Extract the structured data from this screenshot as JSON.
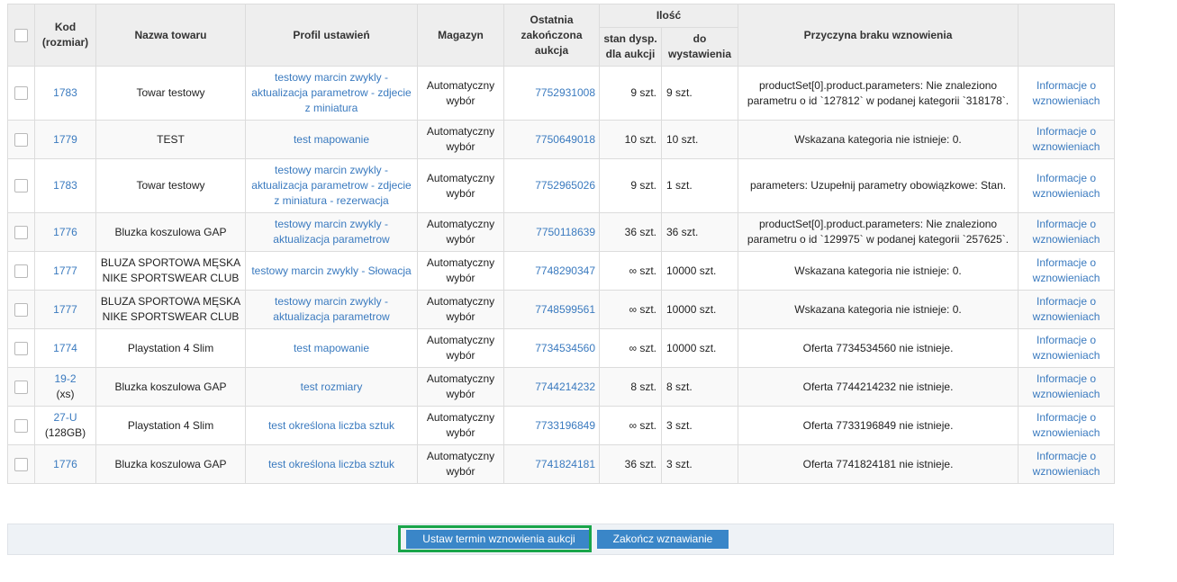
{
  "headers": {
    "kod": "Kod\n(rozmiar)",
    "kod_line1": "Kod",
    "kod_line2": "(rozmiar)",
    "nazwa": "Nazwa towaru",
    "profil": "Profil ustawień",
    "magazyn": "Magazyn",
    "aukcja_line1": "Ostatnia",
    "aukcja_line2": "zakończona",
    "aukcja_line3": "aukcja",
    "ilosc": "Ilość",
    "stan_line1": "stan dysp.",
    "stan_line2": "dla aukcji",
    "do_line1": "do",
    "do_line2": "wystawienia",
    "przyczyna": "Przyczyna braku wznowienia"
  },
  "rows": [
    {
      "kod": "1783",
      "rozmiar": "",
      "nazwa": "Towar testowy",
      "profil": "testowy marcin zwykly - aktualizacja parametrow - zdjecie z miniatura",
      "magazyn": "Automatyczny wybór",
      "aukcja": "7752931008",
      "stan": "9 szt.",
      "do": "9 szt.",
      "przyczyna": "productSet[0].product.parameters: Nie znaleziono parametru o id `127812` w podanej kategorii `318178`.",
      "info": "Informacje o wznowieniach"
    },
    {
      "kod": "1779",
      "rozmiar": "",
      "nazwa": "TEST",
      "profil": "test mapowanie",
      "magazyn": "Automatyczny wybór",
      "aukcja": "7750649018",
      "stan": "10 szt.",
      "do": "10 szt.",
      "przyczyna": "Wskazana kategoria nie istnieje: 0.",
      "info": "Informacje o wznowieniach"
    },
    {
      "kod": "1783",
      "rozmiar": "",
      "nazwa": "Towar testowy",
      "profil": "testowy marcin zwykly - aktualizacja parametrow - zdjecie z miniatura - rezerwacja",
      "magazyn": "Automatyczny wybór",
      "aukcja": "7752965026",
      "stan": "9 szt.",
      "do": "1 szt.",
      "przyczyna": "parameters: Uzupełnij parametry obowiązkowe: Stan.",
      "info": "Informacje o wznowieniach"
    },
    {
      "kod": "1776",
      "rozmiar": "",
      "nazwa": "Bluzka koszulowa GAP",
      "profil": "testowy marcin zwykly - aktualizacja parametrow",
      "magazyn": "Automatyczny wybór",
      "aukcja": "7750118639",
      "stan": "36 szt.",
      "do": "36 szt.",
      "przyczyna": "productSet[0].product.parameters: Nie znaleziono parametru o id `129975` w podanej kategorii `257625`.",
      "info": "Informacje o wznowieniach"
    },
    {
      "kod": "1777",
      "rozmiar": "",
      "nazwa": "BLUZA SPORTOWA MĘSKA NIKE SPORTSWEAR CLUB",
      "profil": "testowy marcin zwykly - Słowacja",
      "magazyn": "Automatyczny wybór",
      "aukcja": "7748290347",
      "stan": "∞ szt.",
      "do": "10000 szt.",
      "przyczyna": "Wskazana kategoria nie istnieje: 0.",
      "info": "Informacje o wznowieniach"
    },
    {
      "kod": "1777",
      "rozmiar": "",
      "nazwa": "BLUZA SPORTOWA MĘSKA NIKE SPORTSWEAR CLUB",
      "profil": "testowy marcin zwykly - aktualizacja parametrow",
      "magazyn": "Automatyczny wybór",
      "aukcja": "7748599561",
      "stan": "∞ szt.",
      "do": "10000 szt.",
      "przyczyna": "Wskazana kategoria nie istnieje: 0.",
      "info": "Informacje o wznowieniach"
    },
    {
      "kod": "1774",
      "rozmiar": "",
      "nazwa": "Playstation 4 Slim",
      "profil": "test mapowanie",
      "magazyn": "Automatyczny wybór",
      "aukcja": "7734534560",
      "stan": "∞ szt.",
      "do": "10000 szt.",
      "przyczyna": "Oferta 7734534560 nie istnieje.",
      "info": "Informacje o wznowieniach"
    },
    {
      "kod": "19-2",
      "rozmiar": "(xs)",
      "nazwa": "Bluzka koszulowa GAP",
      "profil": "test rozmiary",
      "magazyn": "Automatyczny wybór",
      "aukcja": "7744214232",
      "stan": "8 szt.",
      "do": "8 szt.",
      "przyczyna": "Oferta 7744214232 nie istnieje.",
      "info": "Informacje o wznowieniach"
    },
    {
      "kod": "27-U",
      "rozmiar": "(128GB)",
      "nazwa": "Playstation 4 Slim",
      "profil": "test określona liczba sztuk",
      "magazyn": "Automatyczny wybór",
      "aukcja": "7733196849",
      "stan": "∞ szt.",
      "do": "3 szt.",
      "przyczyna": "Oferta 7733196849 nie istnieje.",
      "info": "Informacje o wznowieniach"
    },
    {
      "kod": "1776",
      "rozmiar": "",
      "nazwa": "Bluzka koszulowa GAP",
      "profil": "test określona liczba sztuk",
      "magazyn": "Automatyczny wybór",
      "aukcja": "7741824181",
      "stan": "36 szt.",
      "do": "3 szt.",
      "przyczyna": "Oferta 7741824181 nie istnieje.",
      "info": "Informacje o wznowieniach"
    }
  ],
  "buttons": {
    "set_term": "Ustaw termin wznowienia aukcji",
    "finish": "Zakończ wznawianie"
  },
  "colors": {
    "link": "#3a7abf",
    "button": "#3a86c8",
    "highlight": "#1aa54a",
    "header_bg": "#eeeeee"
  }
}
